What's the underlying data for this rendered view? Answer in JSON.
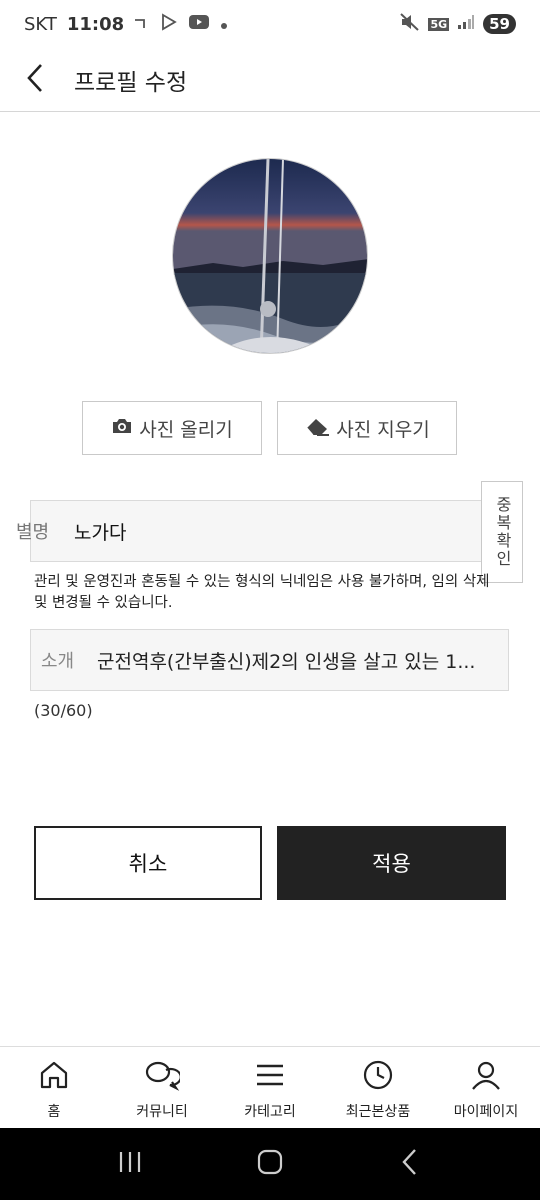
{
  "status_bar": {
    "carrier": "SKT",
    "time": "11:08",
    "network": "5G",
    "battery": "59"
  },
  "header": {
    "title": "프로필 수정"
  },
  "profile": {
    "upload_label": "사진 올리기",
    "delete_label": "사진 지우기"
  },
  "nickname": {
    "label": "별명",
    "value": "노가다",
    "dup_check_label": "중복확인",
    "notice": "관리 및 운영진과 혼동될 수 있는 형식의 닉네임은 사용 불가하며, 임의 삭제 및 변경될 수 있습니다."
  },
  "intro": {
    "label": "소개",
    "value": "군전역후(간부출신)제2의 인생을 살고 있는 1...",
    "count": "(30/60)"
  },
  "actions": {
    "cancel_label": "취소",
    "apply_label": "적용"
  },
  "bottom_nav": [
    {
      "label": "홈",
      "icon": "home-icon"
    },
    {
      "label": "커뮤니티",
      "icon": "chat-bubbles-icon"
    },
    {
      "label": "카테고리",
      "icon": "menu-icon"
    },
    {
      "label": "최근본상품",
      "icon": "clock-icon"
    },
    {
      "label": "마이페이지",
      "icon": "user-icon"
    }
  ],
  "colors": {
    "primary_dark": "#222222",
    "field_bg": "#f6f6f6",
    "border": "#c9c9c9"
  }
}
